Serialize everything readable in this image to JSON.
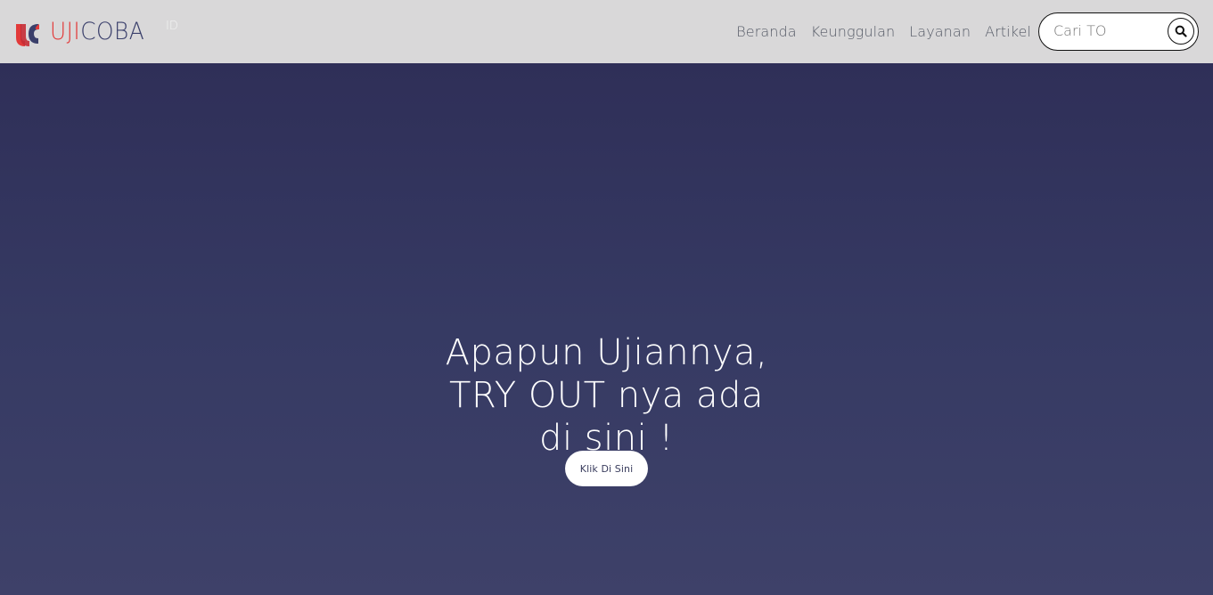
{
  "header": {
    "brand": {
      "part1": "UJI",
      "part2": "COBA",
      "suffix": "ID"
    },
    "nav": [
      {
        "label": "Beranda"
      },
      {
        "label": "Keunggulan"
      },
      {
        "label": "Layanan"
      },
      {
        "label": "Artikel"
      }
    ],
    "search": {
      "placeholder": "Cari TO",
      "icon": "search-icon"
    }
  },
  "hero": {
    "title_lines": [
      "Apapun Ujiannya,",
      "TRY OUT nya ada",
      "di sini !"
    ],
    "cta_label": "Klik Di Sini"
  },
  "colors": {
    "header_bg": "#d9d8d9",
    "brand_red": "#e23a3a",
    "brand_navy": "#3a3f6b",
    "hero_bg_top": "#2f2f58",
    "hero_bg_bottom": "#3e4169"
  }
}
